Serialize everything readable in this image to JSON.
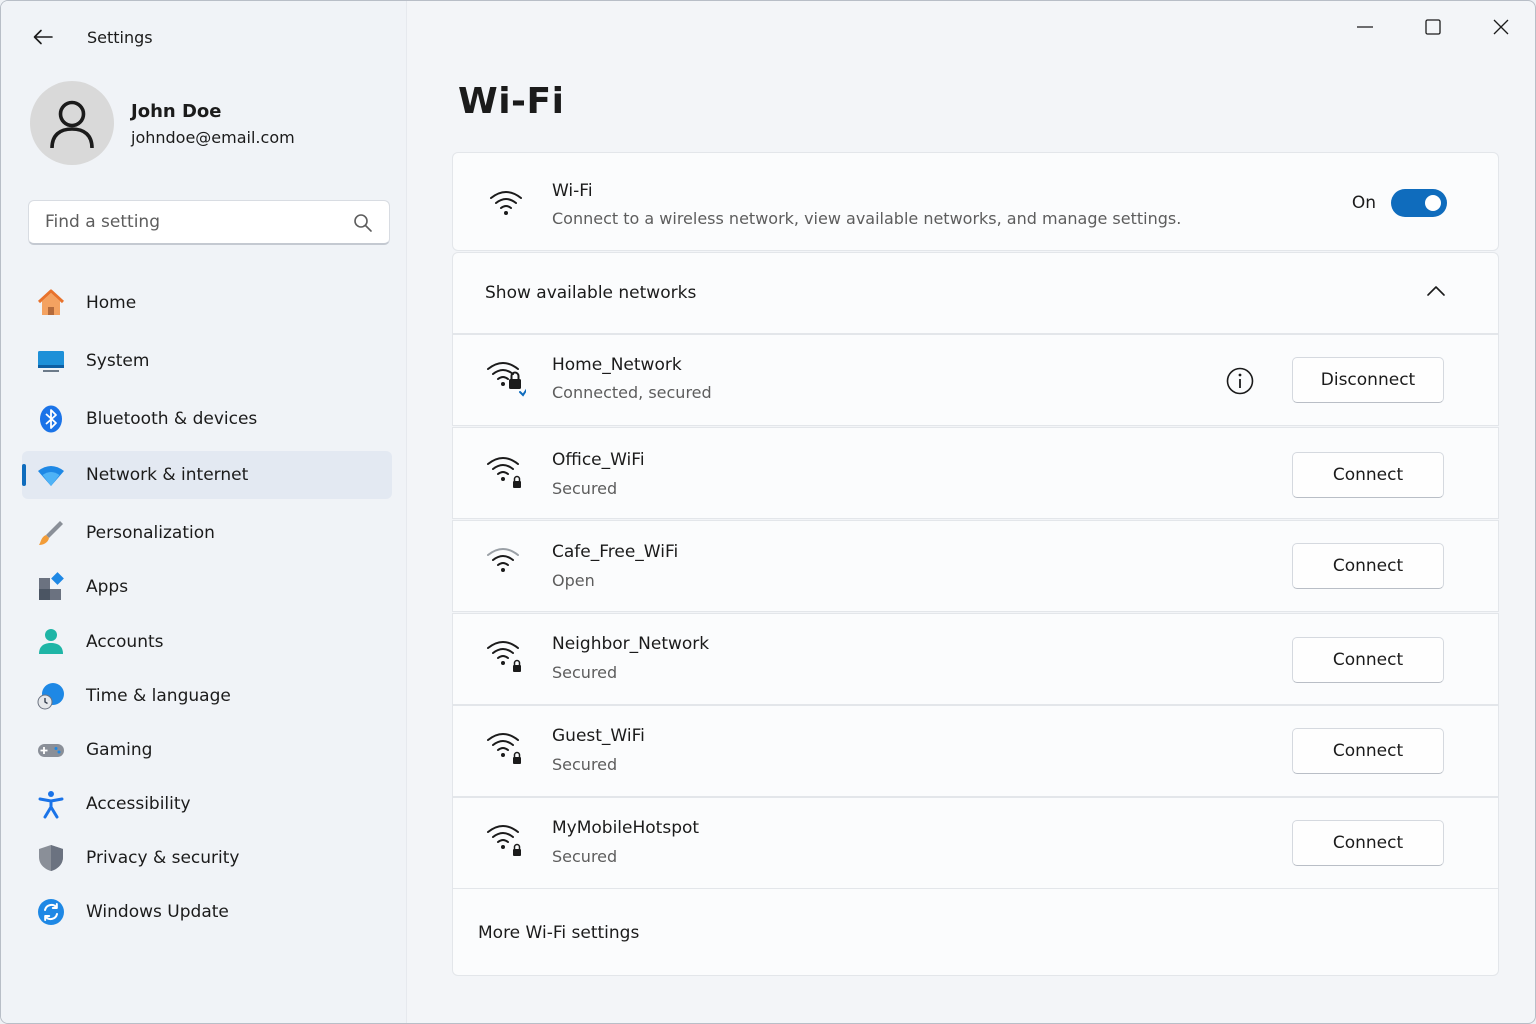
{
  "app": {
    "title": "Settings"
  },
  "profile": {
    "name": "John Doe",
    "email": "johndoe@email.com"
  },
  "search": {
    "placeholder": "Find a setting"
  },
  "sidebar": {
    "items": [
      {
        "label": "Home",
        "icon": "home-icon",
        "active": false
      },
      {
        "label": "System",
        "icon": "system-icon",
        "active": false
      },
      {
        "label": "Bluetooth & devices",
        "icon": "bluetooth-icon",
        "active": false
      },
      {
        "label": "Network & internet",
        "icon": "wifi-icon",
        "active": true
      },
      {
        "label": "Personalization",
        "icon": "brush-icon",
        "active": false
      },
      {
        "label": "Apps",
        "icon": "apps-icon",
        "active": false
      },
      {
        "label": "Accounts",
        "icon": "person-icon",
        "active": false
      },
      {
        "label": "Time & language",
        "icon": "globe-clock-icon",
        "active": false
      },
      {
        "label": "Gaming",
        "icon": "gamepad-icon",
        "active": false
      },
      {
        "label": "Accessibility",
        "icon": "accessibility-icon",
        "active": false
      },
      {
        "label": "Privacy & security",
        "icon": "shield-icon",
        "active": false
      },
      {
        "label": "Windows Update",
        "icon": "update-icon",
        "active": false
      }
    ]
  },
  "page": {
    "title": "Wi-Fi"
  },
  "wifi": {
    "title": "Wi-Fi",
    "description": "Connect to a wireless network, view available networks, and manage settings.",
    "toggle_label": "On",
    "enabled": true
  },
  "available": {
    "label": "Show available networks"
  },
  "networks": [
    {
      "name": "Home_Network",
      "status": "Connected, secured",
      "button": "Disconnect",
      "connected": true,
      "secured": true
    },
    {
      "name": "Office_WiFi",
      "status": "Secured",
      "button": "Connect",
      "connected": false,
      "secured": true
    },
    {
      "name": "Cafe_Free_WiFi",
      "status": "Open",
      "button": "Connect",
      "connected": false,
      "secured": false
    },
    {
      "name": "Neighbor_Network",
      "status": "Secured",
      "button": "Connect",
      "connected": false,
      "secured": true
    },
    {
      "name": "Guest_WiFi",
      "status": "Secured",
      "button": "Connect",
      "connected": false,
      "secured": true
    },
    {
      "name": "MyMobileHotspot",
      "status": "Secured",
      "button": "Connect",
      "connected": false,
      "secured": true
    }
  ],
  "more": {
    "label": "More Wi-Fi settings"
  },
  "colors": {
    "accent": "#0f6cbd",
    "active_bg": "#e3e9f2"
  }
}
